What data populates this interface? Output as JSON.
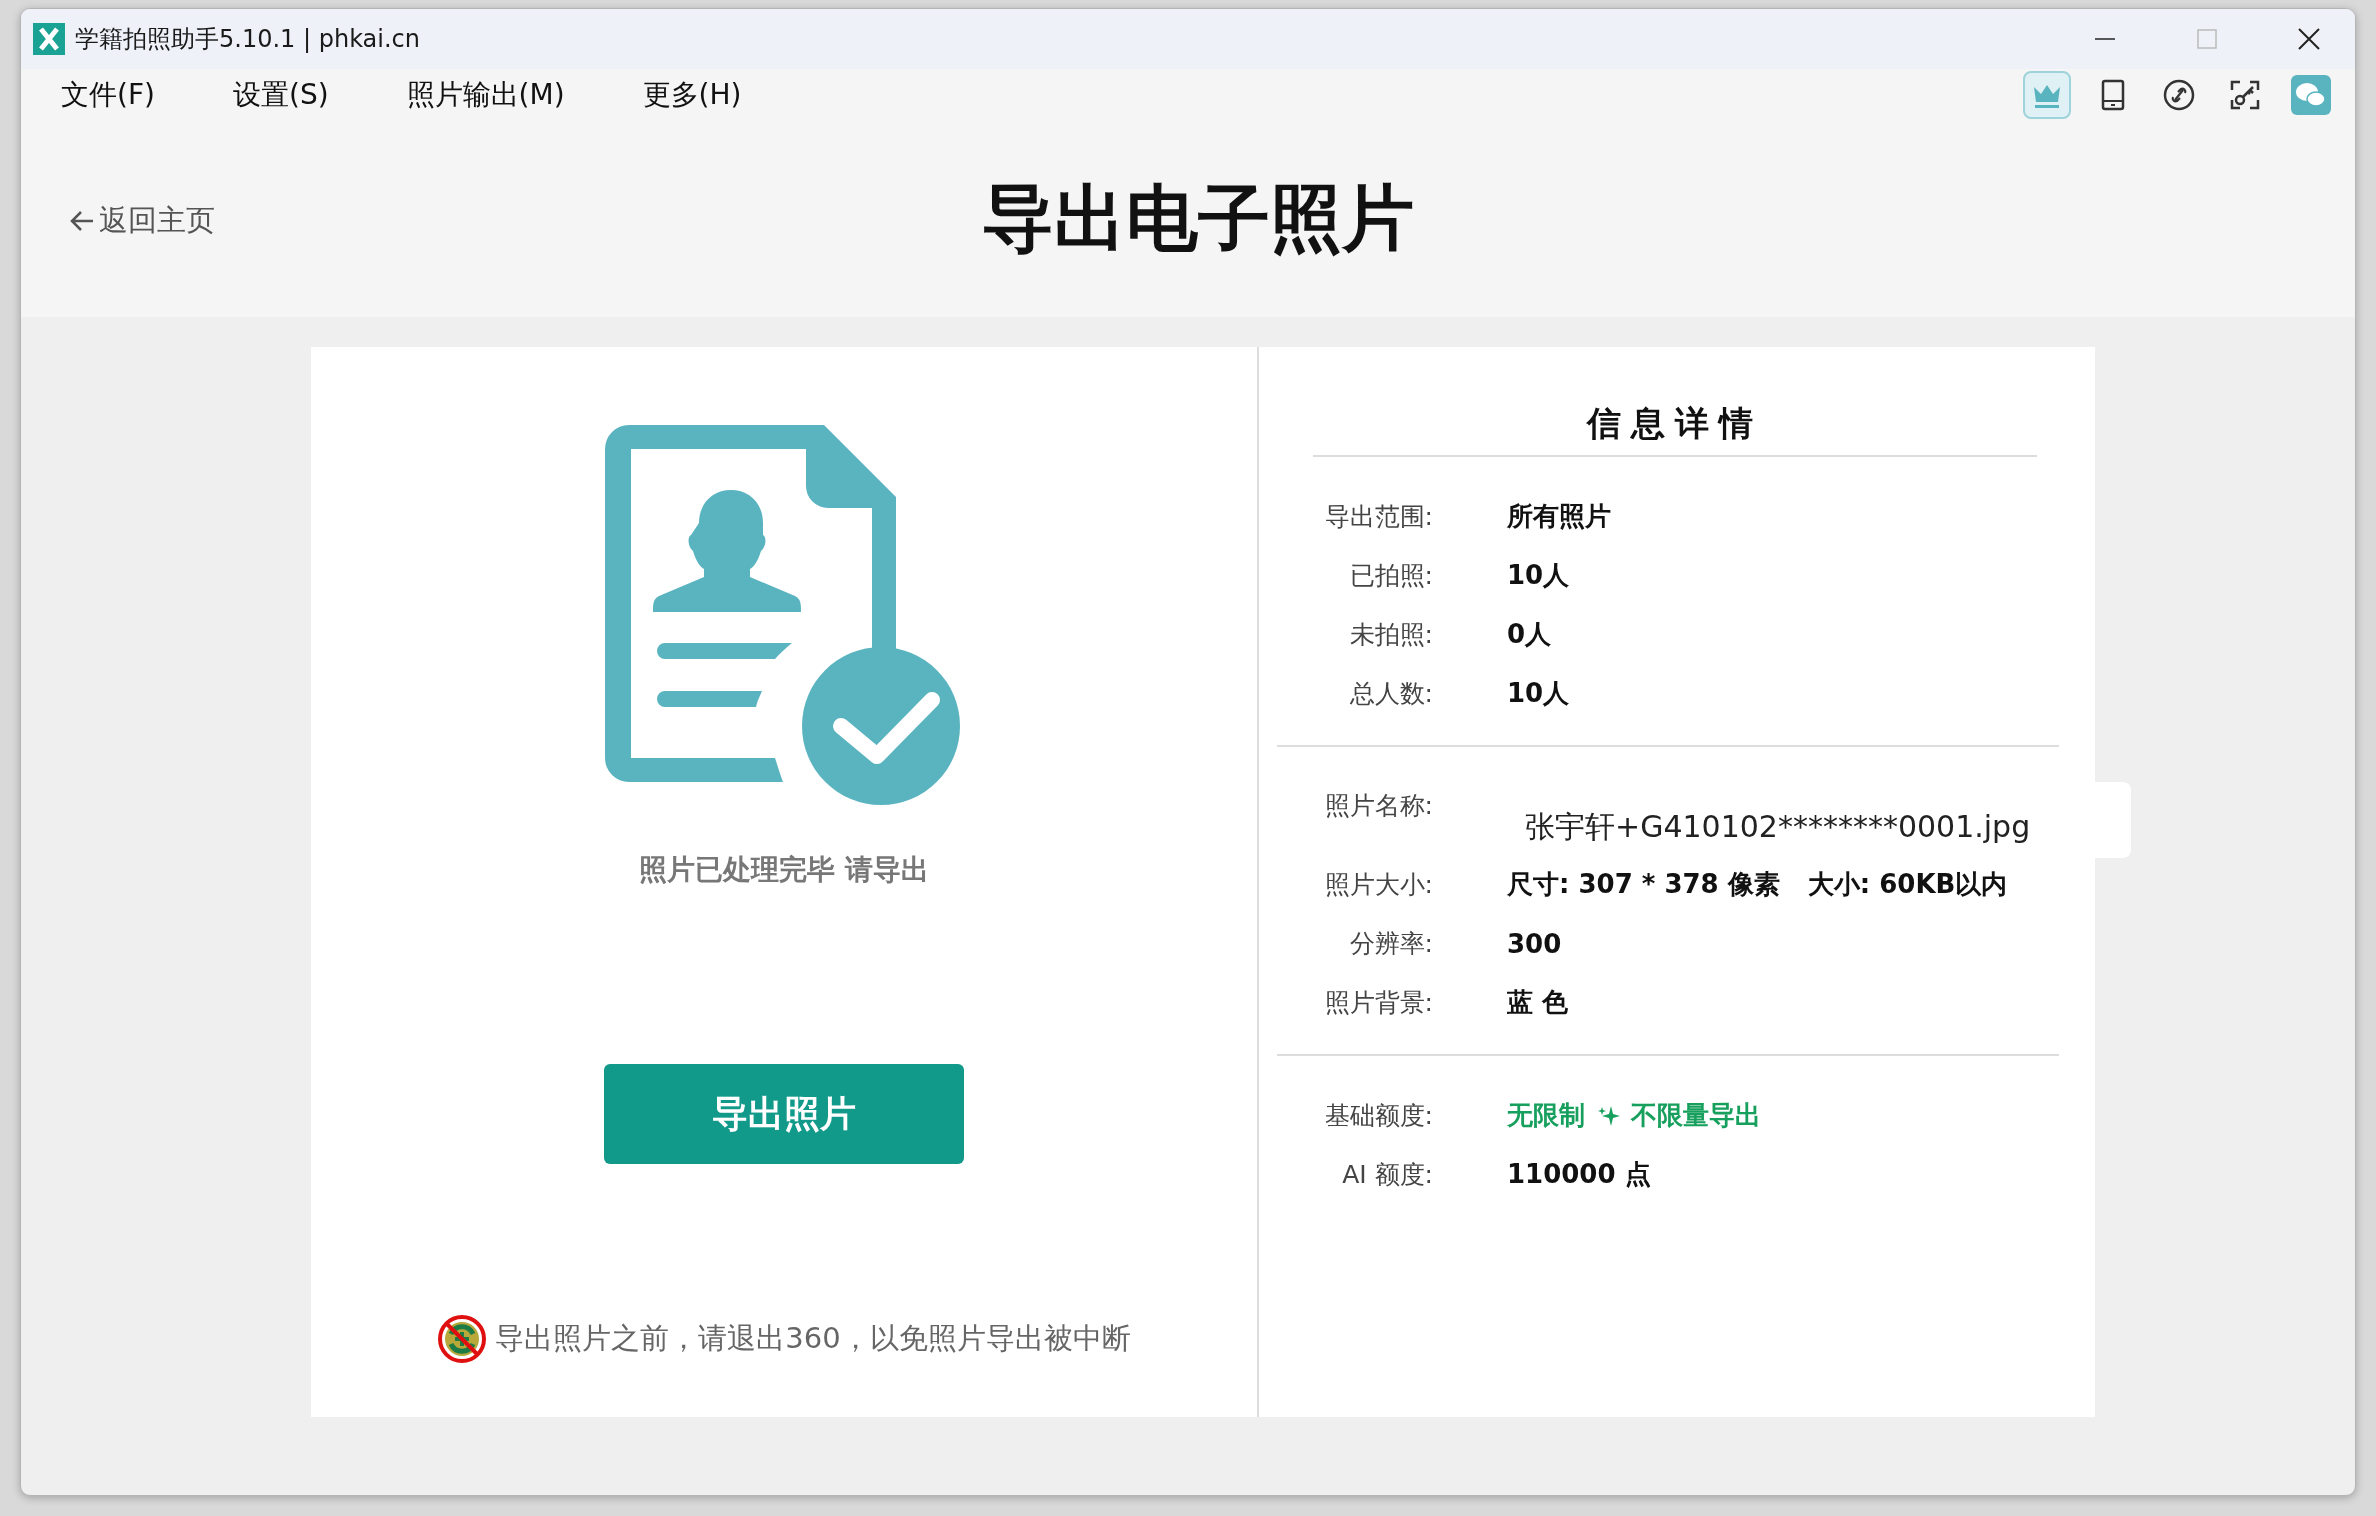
{
  "window": {
    "title": "学籍拍照助手5.10.1 | phkai.cn"
  },
  "menu": [
    "文件(F)",
    "设置(S)",
    "照片输出(M)",
    "更多(H)"
  ],
  "toolbar": [
    {
      "kind": "crown",
      "selected": true
    },
    {
      "kind": "tablet",
      "selected": false
    },
    {
      "kind": "link",
      "selected": false
    },
    {
      "kind": "key",
      "selected": false
    },
    {
      "kind": "chat",
      "selected": false
    }
  ],
  "header": {
    "back": "返回主页",
    "title": "导出电子照片"
  },
  "status": {
    "caption": "照片已处理完毕 请导出",
    "button": "导出照片",
    "warning": "导出照片之前，请退出360，以免照片导出被中断"
  },
  "details": {
    "title": "信息详情",
    "groups": [
      [
        {
          "kind": "plain",
          "label": "导出范围:",
          "values": [
            "所有照片"
          ]
        },
        {
          "kind": "plain",
          "label": "已拍照:",
          "values": [
            "10人"
          ]
        },
        {
          "kind": "plain",
          "label": "未拍照:",
          "values": [
            "0人"
          ]
        },
        {
          "kind": "plain",
          "label": "总人数:",
          "values": [
            "10人"
          ]
        }
      ],
      [
        {
          "kind": "filename",
          "label": "照片名称:",
          "values": [
            "张宇轩+G410102********0001.jpg"
          ]
        },
        {
          "kind": "plain",
          "label": "照片大小:",
          "values": [
            "尺寸: 307 * 378 像素",
            "大小: 60KB以内"
          ]
        },
        {
          "kind": "plain",
          "label": "分辨率:",
          "values": [
            "300"
          ]
        },
        {
          "kind": "plain",
          "label": "照片背景:",
          "values": [
            "蓝 色"
          ]
        }
      ],
      [
        {
          "kind": "quota",
          "label": "基础额度:",
          "values": [
            "无限制",
            "不限量导出"
          ]
        },
        {
          "kind": "plain",
          "label": "AI 额度:",
          "values": [
            "110000 点"
          ]
        }
      ]
    ]
  }
}
